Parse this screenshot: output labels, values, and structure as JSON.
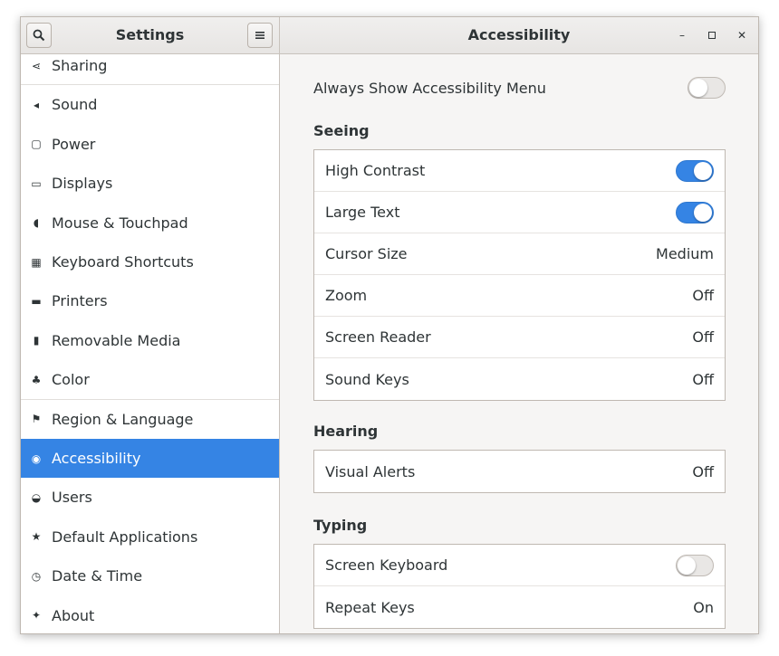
{
  "header": {
    "sidebar_title": "Settings",
    "page_title": "Accessibility",
    "search_icon": "search-icon",
    "menu_icon": "hamburger-menu-icon",
    "controls": {
      "minimize": "–",
      "maximize": "▫",
      "close": "✕"
    }
  },
  "sidebar": {
    "items": [
      {
        "label": "Sharing",
        "icon": "share-icon",
        "glyph": "⋖"
      },
      {
        "label": "Sound",
        "icon": "speaker-icon",
        "glyph": "◂"
      },
      {
        "label": "Power",
        "icon": "power-icon",
        "glyph": "▢"
      },
      {
        "label": "Displays",
        "icon": "display-icon",
        "glyph": "▭"
      },
      {
        "label": "Mouse & Touchpad",
        "icon": "mouse-icon",
        "glyph": "◖"
      },
      {
        "label": "Keyboard Shortcuts",
        "icon": "keyboard-icon",
        "glyph": "▦"
      },
      {
        "label": "Printers",
        "icon": "printer-icon",
        "glyph": "▬"
      },
      {
        "label": "Removable Media",
        "icon": "usb-drive-icon",
        "glyph": "▮"
      },
      {
        "label": "Color",
        "icon": "color-icon",
        "glyph": "♣"
      },
      {
        "label": "Region & Language",
        "icon": "flag-icon",
        "glyph": "⚑"
      },
      {
        "label": "Accessibility",
        "icon": "accessibility-icon",
        "glyph": "◉"
      },
      {
        "label": "Users",
        "icon": "users-icon",
        "glyph": "◒"
      },
      {
        "label": "Default Applications",
        "icon": "star-icon",
        "glyph": "★"
      },
      {
        "label": "Date & Time",
        "icon": "clock-icon",
        "glyph": "◷"
      },
      {
        "label": "About",
        "icon": "about-icon",
        "glyph": "✦"
      }
    ],
    "selected": "Accessibility"
  },
  "content": {
    "always_show": {
      "label": "Always Show Accessibility Menu",
      "enabled": false
    },
    "seeing": {
      "title": "Seeing",
      "rows": [
        {
          "label": "High Contrast",
          "type": "switch",
          "enabled": true
        },
        {
          "label": "Large Text",
          "type": "switch",
          "enabled": true
        },
        {
          "label": "Cursor Size",
          "type": "value",
          "value": "Medium"
        },
        {
          "label": "Zoom",
          "type": "value",
          "value": "Off"
        },
        {
          "label": "Screen Reader",
          "type": "value",
          "value": "Off"
        },
        {
          "label": "Sound Keys",
          "type": "value",
          "value": "Off"
        }
      ]
    },
    "hearing": {
      "title": "Hearing",
      "rows": [
        {
          "label": "Visual Alerts",
          "type": "value",
          "value": "Off"
        }
      ]
    },
    "typing": {
      "title": "Typing",
      "rows": [
        {
          "label": "Screen Keyboard",
          "type": "switch",
          "enabled": false
        },
        {
          "label": "Repeat Keys",
          "type": "value",
          "value": "On"
        }
      ]
    }
  },
  "colors": {
    "accent": "#3584e4",
    "window_bg": "#f6f5f4",
    "border": "#bfb8b1"
  }
}
